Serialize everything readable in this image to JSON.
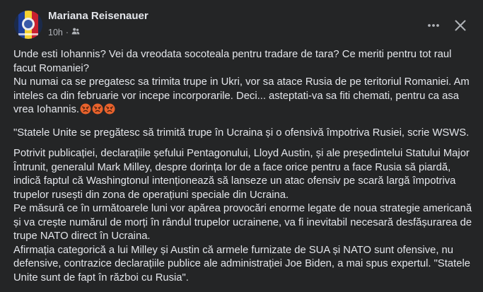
{
  "post": {
    "author": "Mariana Reisenauer",
    "timestamp": "10h",
    "separator": "·",
    "audience_icon": "friends-icon",
    "more_icon": "more-horizontal-icon",
    "close_icon": "close-icon",
    "emoji_icon": "angry-face-emoji",
    "paragraph_1": "Unde esti Iohannis? Vei da vreodata socoteala pentru tradare de tara? Ce meriti pentru tot raul facut Romaniei?\nNu numai ca se pregatesc sa trimita trupe in Ukri, vor sa atace Rusia  de pe teritoriul Romaniei. Am inteles ca din februarie vor incepe incorporarile. Deci... asteptati-va sa fiti chemati, pentru ca asa vrea Iohannis.",
    "paragraph_2": "\"Statele Unite se pregătesc să trimită trupe în Ucraina și o ofensivă împotriva Rusiei, scrie WSWS.",
    "paragraph_3": "Potrivit publicației, declarațiile șefului Pentagonului, Lloyd Austin, și ale președintelui Statului Major Întrunit, generalul Mark Milley, despre dorința lor de a face orice pentru a face Rusia să piardă, indică faptul că Washingtonul intenționează să lanseze un atac ofensiv pe scară largă împotriva trupelor rusești din zona de operațiuni speciale din Ucraina.\nPe măsură ce în următoarele luni vor apărea provocări enorme legate de noua strategie americană și va crește numărul de morți în rândul trupelor ucrainene, va fi inevitabil necesară desfășurarea de trupe NATO direct în Ucraina.\nAfirmația categorică a lui Milley și Austin că armele furnizate de SUA și NATO sunt ofensive, nu defensive, contrazice declarațiile publice ale administrației Joe Biden, a mai spus expertul. \"Statele Unite sunt de fapt în război cu Rusia\"."
  }
}
